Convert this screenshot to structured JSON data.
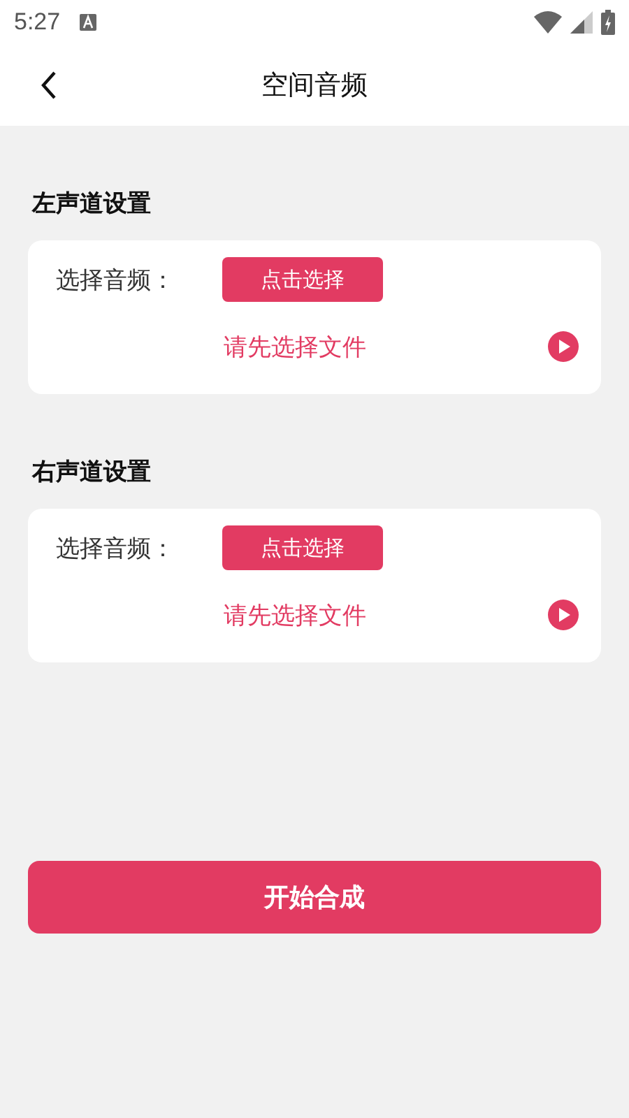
{
  "status_bar": {
    "time": "5:27"
  },
  "header": {
    "title": "空间音频"
  },
  "sections": [
    {
      "title": "左声道设置",
      "label": "选择音频：",
      "button": "点击选择",
      "file": "请先选择文件"
    },
    {
      "title": "右声道设置",
      "label": "选择音频：",
      "button": "点击选择",
      "file": "请先选择文件"
    }
  ],
  "action_button": "开始合成"
}
